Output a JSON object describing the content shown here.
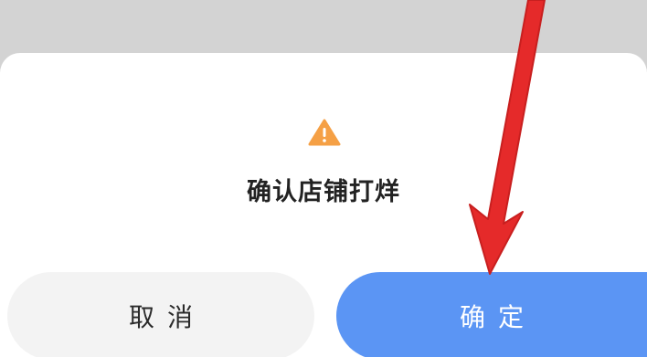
{
  "dialog": {
    "title": "确认店铺打烊",
    "icon": "warning-icon",
    "cancel_label": "取消",
    "confirm_label": "确定"
  },
  "colors": {
    "warning": "#f5a045",
    "confirm": "#5b95f4",
    "cancel_bg": "#f3f3f3",
    "annotation_arrow": "#e52a2a"
  },
  "annotation": {
    "arrow_target": "confirm-button"
  }
}
